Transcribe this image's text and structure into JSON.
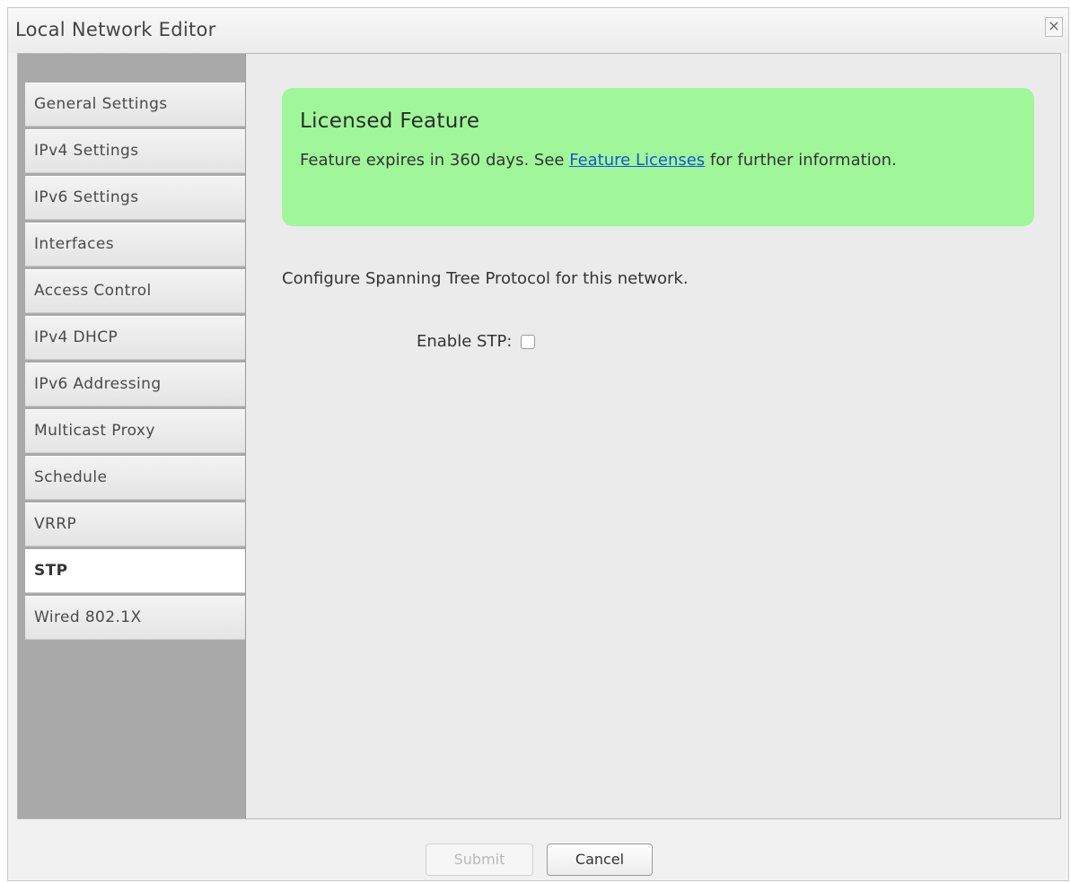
{
  "window": {
    "title": "Local Network Editor",
    "close_glyph": "×"
  },
  "sidebar": {
    "items": [
      {
        "label": "General Settings",
        "active": false
      },
      {
        "label": "IPv4 Settings",
        "active": false
      },
      {
        "label": "IPv6 Settings",
        "active": false
      },
      {
        "label": "Interfaces",
        "active": false
      },
      {
        "label": "Access Control",
        "active": false
      },
      {
        "label": "IPv4 DHCP",
        "active": false
      },
      {
        "label": "IPv6 Addressing",
        "active": false
      },
      {
        "label": "Multicast Proxy",
        "active": false
      },
      {
        "label": "Schedule",
        "active": false
      },
      {
        "label": "VRRP",
        "active": false
      },
      {
        "label": "STP",
        "active": true
      },
      {
        "label": "Wired 802.1X",
        "active": false
      }
    ]
  },
  "license_box": {
    "title": "Licensed Feature",
    "text_before": "Feature expires in 360 days. See ",
    "link_label": "Feature Licenses",
    "text_after": " for further information.",
    "background_color": "#a0f79a"
  },
  "main": {
    "description": "Configure Spanning Tree Protocol for this network.",
    "enable_stp_label": "Enable STP:",
    "enable_stp_checked": false
  },
  "footer": {
    "submit_label": "Submit",
    "submit_disabled": true,
    "cancel_label": "Cancel"
  }
}
